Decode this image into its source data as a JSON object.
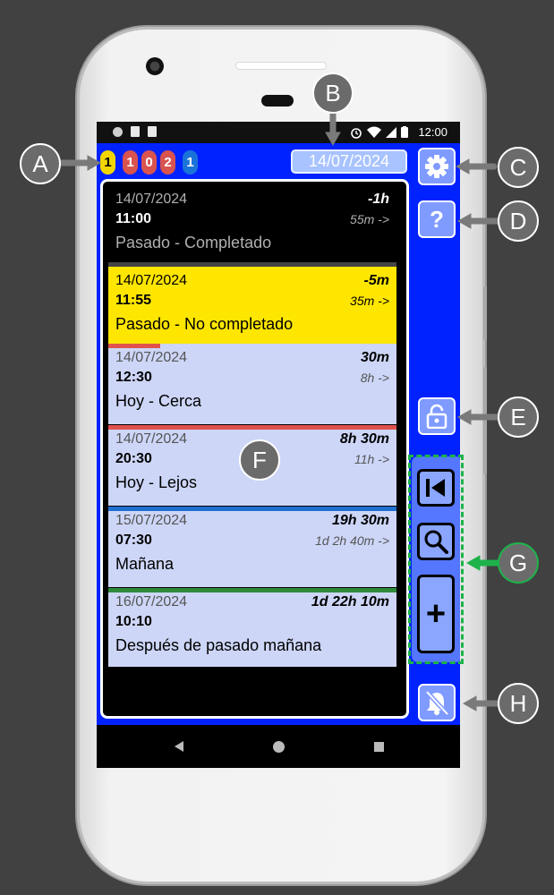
{
  "statusbar": {
    "time": "12:00"
  },
  "counters": [
    {
      "value": "1",
      "color": "#f2d600",
      "text_color": "#000000"
    },
    {
      "value": "1",
      "color": "#d9534f",
      "text_color": "#ffffff"
    },
    {
      "value": "0",
      "color": "#d9534f",
      "text_color": "#ffffff"
    },
    {
      "value": "2",
      "color": "#d9534f",
      "text_color": "#ffffff"
    },
    {
      "value": "1",
      "color": "#1a73d9",
      "text_color": "#ffffff"
    }
  ],
  "header": {
    "date": "14/07/2024"
  },
  "events": [
    {
      "date": "14/07/2024",
      "relative": "-1h",
      "time": "11:00",
      "countdown": "55m ->",
      "title": "Pasado - Completado",
      "bg": "#000000",
      "fg": "#b0b0b0",
      "hourfg": "#ffffff",
      "stripe": "#444444"
    },
    {
      "date": "14/07/2024",
      "relative": "-5m",
      "time": "11:55",
      "countdown": "35m ->",
      "title": "Pasado - No completado",
      "bg": "#ffe600",
      "fg": "#000000",
      "hourfg": "#000000",
      "stripe": "#444444"
    },
    {
      "date": "14/07/2024",
      "relative": "30m",
      "time": "12:30",
      "countdown": "8h ->",
      "title": "Hoy - Cerca",
      "bg": "#cdd6f7",
      "fg": "#000000",
      "hourfg": "#000000",
      "stripe": "#e0524d"
    },
    {
      "date": "14/07/2024",
      "relative": "8h 30m",
      "time": "20:30",
      "countdown": "11h ->",
      "title": "Hoy - Lejos",
      "bg": "#cdd6f7",
      "fg": "#000000",
      "hourfg": "#000000",
      "stripe": "#e0524d"
    },
    {
      "date": "15/07/2024",
      "relative": "19h 30m",
      "time": "07:30",
      "countdown": "1d 2h 40m ->",
      "title": "Mañana",
      "bg": "#cdd6f7",
      "fg": "#000000",
      "hourfg": "#000000",
      "stripe": "#1f6fd1"
    },
    {
      "date": "16/07/2024",
      "relative": "1d 22h 10m",
      "time": "10:10",
      "countdown": "",
      "title": "Después de pasado mañana",
      "bg": "#cdd6f7",
      "fg": "#000000",
      "hourfg": "#000000",
      "stripe": "#2e8b3a"
    }
  ],
  "icons": {
    "settings": "gear-icon",
    "help": "question-icon",
    "lock": "unlock-icon",
    "first": "skip-first-icon",
    "search": "search-icon",
    "add": "plus-icon",
    "mute": "bell-off-icon"
  },
  "help_label": "?",
  "add_label": "+",
  "callouts": {
    "a": "A",
    "b": "B",
    "c": "C",
    "d": "D",
    "e": "E",
    "f": "F",
    "g": "G",
    "h": "H"
  }
}
